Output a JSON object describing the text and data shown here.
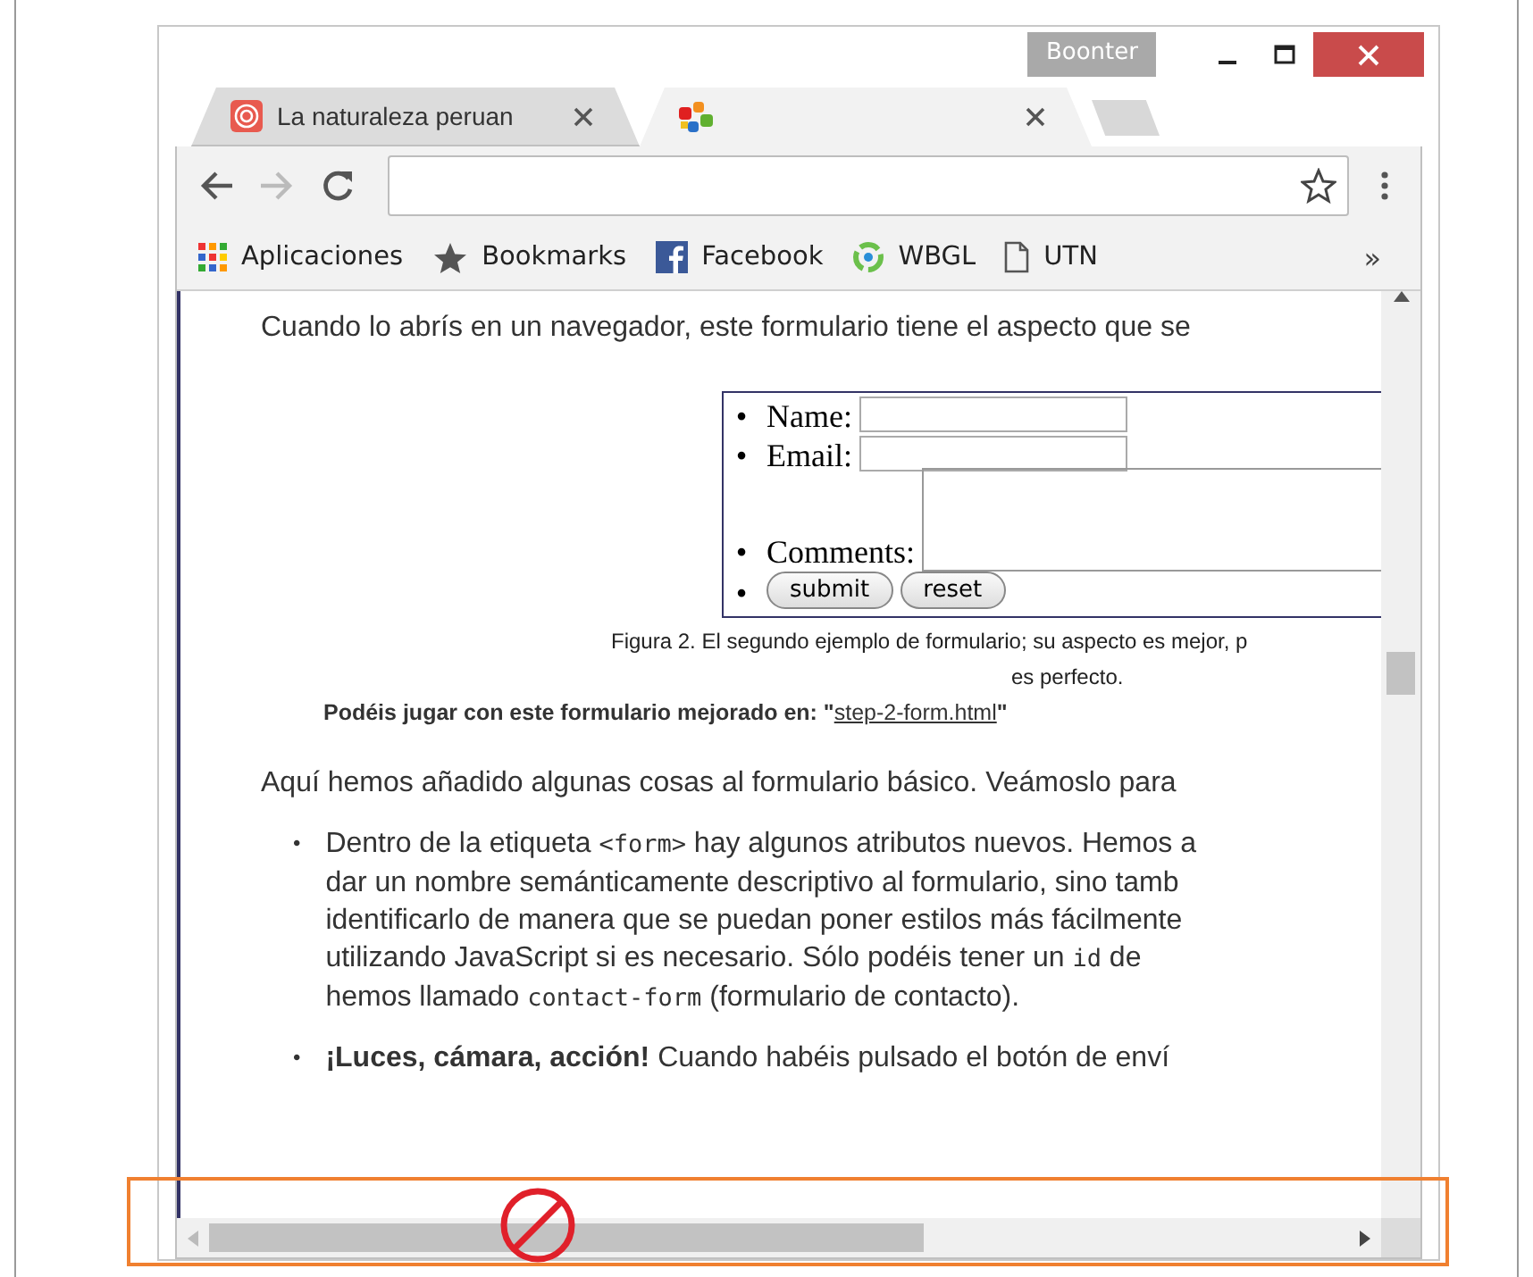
{
  "window": {
    "profile": "Boonter",
    "controls": [
      {
        "kind": "minimize"
      },
      {
        "kind": "maximize"
      },
      {
        "kind": "close"
      }
    ]
  },
  "tabs": [
    {
      "title": "La naturaleza peruan",
      "selected": false
    },
    {
      "selected": true
    }
  ],
  "nav": [
    {
      "kind": "back",
      "disabled": false
    },
    {
      "kind": "forward",
      "disabled": true
    },
    {
      "kind": "reload",
      "disabled": false
    }
  ],
  "bookmarks": [
    {
      "label": "Aplicaciones",
      "kind": "apps"
    },
    {
      "label": "Bookmarks",
      "kind": "star"
    },
    {
      "label": "Facebook",
      "kind": "facebook"
    },
    {
      "label": "WBGL",
      "kind": "ring"
    },
    {
      "label": "UTN",
      "kind": "page"
    }
  ],
  "bookmarks_overflow": "»",
  "page": {
    "intro": "Cuando lo abrís en un navegador, este formulario tiene el aspecto que se",
    "form": [
      {
        "kind": "input",
        "bullet": "•",
        "label": "Name:"
      },
      {
        "kind": "input",
        "bullet": "•",
        "label": "Email:"
      },
      {
        "kind": "textarea",
        "bullet": "•",
        "label": "Comments:"
      },
      {
        "kind": "buttons",
        "bullet": "•",
        "buttons": [
          "submit",
          "reset"
        ]
      }
    ],
    "caption": [
      "Figura 2. El segundo ejemplo de formulario; su aspecto es mejor, p",
      "es perfecto."
    ],
    "try_line": {
      "text": "Podéis jugar con este formulario mejorado en: \"",
      "link": "step-2-form.html",
      "after": "\""
    },
    "paragraph": "Aquí hemos añadido algunas cosas al formulario básico. Veámoslo para",
    "list": [
      {
        "bullet": "•",
        "lines": [
          [
            {
              "text": "Dentro de la etiqueta "
            },
            {
              "text": "<form>",
              "code": true
            },
            {
              "text": " hay algunos atributos nuevos. Hemos a"
            }
          ],
          [
            {
              "text": "dar un nombre semánticamente descriptivo al formulario, sino tamb"
            }
          ],
          [
            {
              "text": "identificarlo de manera que se puedan poner estilos más fácilmente"
            }
          ],
          [
            {
              "text": "utilizando JavaScript si es necesario. Sólo podéis tener un "
            },
            {
              "text": "id",
              "code": true
            },
            {
              "text": " de"
            }
          ],
          [
            {
              "text": "hemos llamado "
            },
            {
              "text": "contact-form",
              "code": true
            },
            {
              "text": " (formulario de contacto)."
            }
          ]
        ]
      },
      {
        "bullet": "•",
        "lines": [
          [
            {
              "text": "**¡Luces, cámara, acción!** Cuando habéis pulsado el botón de enví"
            }
          ]
        ]
      }
    ]
  },
  "annotations": {
    "highlight_box": true,
    "prohibited_mark": true
  }
}
